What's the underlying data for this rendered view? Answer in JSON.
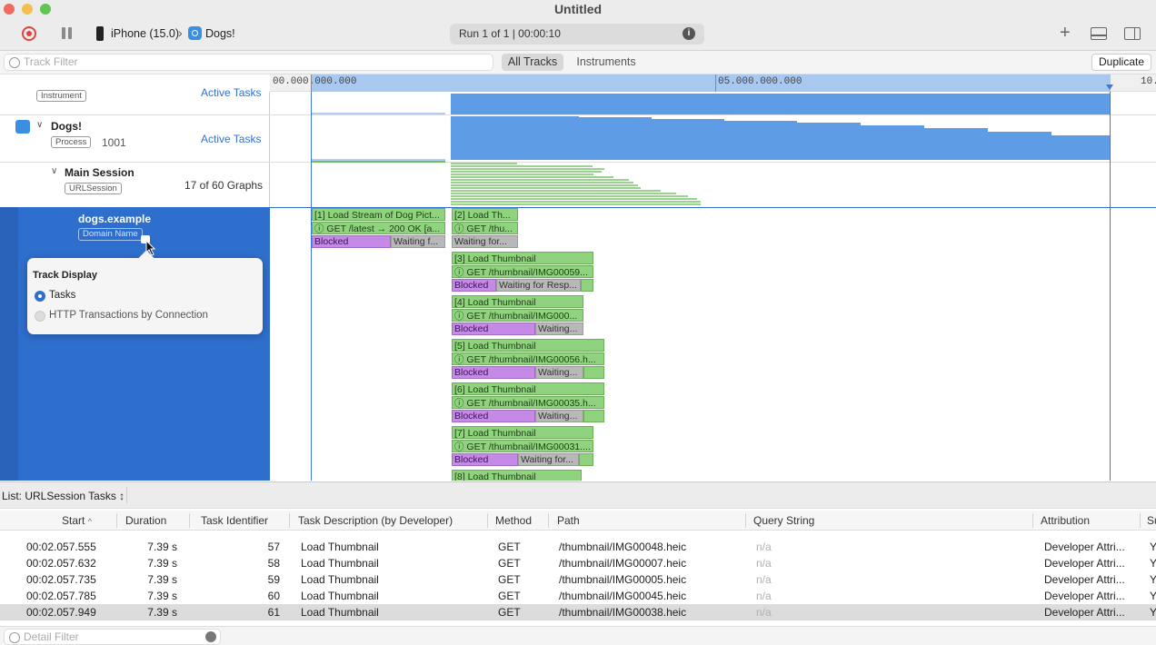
{
  "window": {
    "title": "Untitled"
  },
  "toolbar": {
    "device": "iPhone (15.0)",
    "app": "Dogs!",
    "run_status": "Run 1 of 1  |  00:00:10"
  },
  "filter": {
    "placeholder": "Track Filter",
    "segments": [
      "All Tracks",
      "Instruments"
    ],
    "duplicate_label": "Duplicate"
  },
  "ruler": {
    "labels": [
      "00.000.000.000",
      "05.000.000.000",
      "10."
    ]
  },
  "tracks": {
    "instrument": {
      "pill": "Instrument",
      "link": "Active Tasks"
    },
    "dogs": {
      "name": "Dogs!",
      "pill": "Process",
      "pid": "1001",
      "link": "Active Tasks"
    },
    "session": {
      "name": "Main Session",
      "pill": "URLSession",
      "graphs": "17 of 60 Graphs"
    },
    "domain": {
      "name": "dogs.example",
      "pill": "Domain Name"
    }
  },
  "popover": {
    "title": "Track Display",
    "options": [
      "Tasks",
      "HTTP Transactions by Connection"
    ],
    "selected": 0
  },
  "tasks": [
    {
      "l1": "[1] Load Stream of Dog Pict...",
      "l2": "ⓘ GET /latest → 200 OK [a...",
      "blocked": "Blocked",
      "waiting": "Waiting f..."
    },
    {
      "l1": "[2] Load Th...",
      "l2": "ⓘ GET /thu...",
      "blocked": "",
      "waiting": "Waiting for..."
    },
    {
      "l1": "[3] Load Thumbnail",
      "l2": "ⓘ GET /thumbnail/IMG00059...",
      "blocked": "Blocked",
      "waiting": "Waiting for Resp..."
    },
    {
      "l1": "[4] Load Thumbnail",
      "l2": "ⓘ GET /thumbnail/IMG000...",
      "blocked": "Blocked",
      "waiting": "Waiting..."
    },
    {
      "l1": "[5] Load Thumbnail",
      "l2": "ⓘ GET /thumbnail/IMG00056.h...",
      "blocked": "Blocked",
      "waiting": "Waiting..."
    },
    {
      "l1": "[6] Load Thumbnail",
      "l2": "ⓘ GET /thumbnail/IMG00035.h...",
      "blocked": "Blocked",
      "waiting": "Waiting..."
    },
    {
      "l1": "[7] Load Thumbnail",
      "l2": "ⓘ GET /thumbnail/IMG00031....",
      "blocked": "Blocked",
      "waiting": "Waiting for..."
    },
    {
      "l1": "[8] Load Thumbnail",
      "l2": "",
      "blocked": "",
      "waiting": ""
    }
  ],
  "list": {
    "title": "List: URLSession Tasks ↕",
    "columns": [
      "Start",
      "Duration",
      "Task Identifier",
      "Task Description (by Developer)",
      "Method",
      "Path",
      "Query String",
      "Attribution",
      "Su"
    ],
    "rows": [
      {
        "start": "00:02.057.555",
        "duration": "7.39 s",
        "id": "57",
        "desc": "Load Thumbnail",
        "method": "GET",
        "path": "/thumbnail/IMG00048.heic",
        "query": "n/a",
        "attribution": "Developer Attri...",
        "s": "Y"
      },
      {
        "start": "00:02.057.632",
        "duration": "7.39 s",
        "id": "58",
        "desc": "Load Thumbnail",
        "method": "GET",
        "path": "/thumbnail/IMG00007.heic",
        "query": "n/a",
        "attribution": "Developer Attri...",
        "s": "Y"
      },
      {
        "start": "00:02.057.735",
        "duration": "7.39 s",
        "id": "59",
        "desc": "Load Thumbnail",
        "method": "GET",
        "path": "/thumbnail/IMG00005.heic",
        "query": "n/a",
        "attribution": "Developer Attri...",
        "s": "Y"
      },
      {
        "start": "00:02.057.785",
        "duration": "7.39 s",
        "id": "60",
        "desc": "Load Thumbnail",
        "method": "GET",
        "path": "/thumbnail/IMG00045.heic",
        "query": "n/a",
        "attribution": "Developer Attri...",
        "s": "Y"
      },
      {
        "start": "00:02.057.949",
        "duration": "7.39 s",
        "id": "61",
        "desc": "Load Thumbnail",
        "method": "GET",
        "path": "/thumbnail/IMG00038.heic",
        "query": "n/a",
        "attribution": "Developer Attri...",
        "s": "Y"
      }
    ]
  },
  "footer": {
    "detail_filter_placeholder": "Detail Filter"
  },
  "colors": {
    "accent": "#2e6ecc",
    "graph_fill": "#5f9ce6",
    "task_green": "#8fd37e",
    "blocked_purple": "#c58ae6",
    "record_red": "#e0443e"
  }
}
